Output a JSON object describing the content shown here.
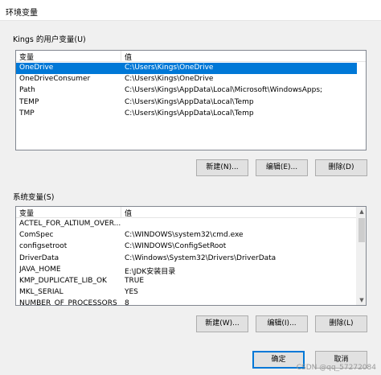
{
  "window": {
    "title": "环境变量"
  },
  "user_vars": {
    "group_label": "Kings 的用户变量(U)",
    "columns": [
      "变量",
      "值"
    ],
    "rows": [
      {
        "name": "OneDrive",
        "value": "C:\\Users\\Kings\\OneDrive",
        "selected": true
      },
      {
        "name": "OneDriveConsumer",
        "value": "C:\\Users\\Kings\\OneDrive"
      },
      {
        "name": "Path",
        "value": "C:\\Users\\Kings\\AppData\\Local\\Microsoft\\WindowsApps;"
      },
      {
        "name": "TEMP",
        "value": "C:\\Users\\Kings\\AppData\\Local\\Temp"
      },
      {
        "name": "TMP",
        "value": "C:\\Users\\Kings\\AppData\\Local\\Temp"
      }
    ],
    "buttons": {
      "new": "新建(N)...",
      "edit": "编辑(E)...",
      "delete": "删除(D)"
    }
  },
  "system_vars": {
    "group_label": "系统变量(S)",
    "columns": [
      "变量",
      "值"
    ],
    "rows": [
      {
        "name": "ACTEL_FOR_ALTIUM_OVER...",
        "value": ""
      },
      {
        "name": "ComSpec",
        "value": "C:\\WINDOWS\\system32\\cmd.exe"
      },
      {
        "name": "configsetroot",
        "value": "C:\\WINDOWS\\ConfigSetRoot"
      },
      {
        "name": "DriverData",
        "value": "C:\\Windows\\System32\\Drivers\\DriverData"
      },
      {
        "name": "JAVA_HOME",
        "value": "E:\\JDK安装目录"
      },
      {
        "name": "KMP_DUPLICATE_LIB_OK",
        "value": "TRUE"
      },
      {
        "name": "MKL_SERIAL",
        "value": "YES"
      },
      {
        "name": "NUMBER_OF_PROCESSORS",
        "value": "8"
      }
    ],
    "buttons": {
      "new": "新建(W)...",
      "edit": "编辑(I)...",
      "delete": "删除(L)"
    }
  },
  "footer": {
    "ok": "确定",
    "cancel": "取消"
  },
  "watermark": "CSDN @qq_57272084",
  "colors": {
    "selection": "#0078d7",
    "button_face": "#e1e1e1",
    "dialog_bg": "#f0f0f0"
  }
}
